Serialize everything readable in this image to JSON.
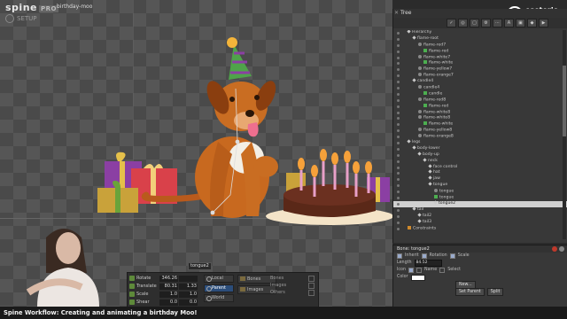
{
  "app": {
    "logo": "spine",
    "edition": "PRO",
    "filename": "birthday-moo",
    "mode_label": "SETUP"
  },
  "bone_tooltip": "tongue2",
  "tools": {
    "transform": [
      {
        "label": "Rotate",
        "x": "346.26",
        "y": ""
      },
      {
        "label": "Translate",
        "x": "80.31",
        "y": "1.33"
      },
      {
        "label": "Scale",
        "x": "1.0",
        "y": "1.0"
      },
      {
        "label": "Shear",
        "x": "0.0",
        "y": "0.0"
      }
    ],
    "axes": [
      {
        "label": "Local",
        "active": false
      },
      {
        "label": "Parent",
        "active": true
      },
      {
        "label": "World",
        "active": false
      }
    ],
    "compensate": [
      "Bones",
      "Images"
    ],
    "options": [
      "Bones",
      "Images",
      "Others"
    ]
  },
  "tree": {
    "title": "Tree",
    "search_label": "Search",
    "nodes": [
      {
        "label": "Hierarchy",
        "kind": "bone",
        "indent": 1
      },
      {
        "label": "flame-root",
        "kind": "bone",
        "indent": 2
      },
      {
        "label": "flame-red7",
        "kind": "slot",
        "indent": 3
      },
      {
        "label": "flame-red",
        "kind": "att",
        "indent": 4
      },
      {
        "label": "flame-white7",
        "kind": "slot",
        "indent": 3
      },
      {
        "label": "flame-white",
        "kind": "att",
        "indent": 4
      },
      {
        "label": "flame-yellow7",
        "kind": "slot",
        "indent": 3
      },
      {
        "label": "flame-orange7",
        "kind": "slot",
        "indent": 3
      },
      {
        "label": "candle4",
        "kind": "bone",
        "indent": 2
      },
      {
        "label": "candle4",
        "kind": "slot",
        "indent": 3
      },
      {
        "label": "candle",
        "kind": "att",
        "indent": 4
      },
      {
        "label": "flame-red8",
        "kind": "slot",
        "indent": 3
      },
      {
        "label": "flame-red",
        "kind": "att",
        "indent": 4
      },
      {
        "label": "flame-white8",
        "kind": "slot",
        "indent": 3
      },
      {
        "label": "flame-white8",
        "kind": "slot",
        "indent": 3
      },
      {
        "label": "flame-white",
        "kind": "att",
        "indent": 4
      },
      {
        "label": "flame-yellow8",
        "kind": "slot",
        "indent": 3
      },
      {
        "label": "flame-orange8",
        "kind": "slot",
        "indent": 3
      },
      {
        "label": "legs",
        "kind": "bone",
        "indent": 1
      },
      {
        "label": "body-lower",
        "kind": "bone",
        "indent": 2
      },
      {
        "label": "body-up",
        "kind": "bone",
        "indent": 3
      },
      {
        "label": "neck",
        "kind": "bone",
        "indent": 4
      },
      {
        "label": "face control",
        "kind": "bone",
        "indent": 5
      },
      {
        "label": "hat",
        "kind": "bone",
        "indent": 5
      },
      {
        "label": "jaw",
        "kind": "bone",
        "indent": 5
      },
      {
        "label": "tongue",
        "kind": "bone",
        "indent": 5
      },
      {
        "label": "tongue",
        "kind": "slot",
        "indent": 6
      },
      {
        "label": "tongue",
        "kind": "att",
        "indent": 6
      },
      {
        "label": "tongue2",
        "kind": "bone",
        "indent": 6,
        "selected": true
      },
      {
        "label": "tail",
        "kind": "bone",
        "indent": 2
      },
      {
        "label": "tail2",
        "kind": "bone",
        "indent": 3
      },
      {
        "label": "tail3",
        "kind": "bone",
        "indent": 3
      },
      {
        "label": "Constraints",
        "kind": "warm",
        "indent": 1
      }
    ]
  },
  "props": {
    "title": "Bone: tongue2",
    "inherit_label": "Inherit",
    "rotation_label": "Rotation",
    "scale_label": "Scale",
    "length_label": "Length",
    "length_value": "84.52",
    "icon_label": "Icon",
    "name_label": "Name",
    "select_label": "Select",
    "color_label": "Color",
    "new_button": "New...",
    "set_parent_button": "Set Parent",
    "split_button": "Split"
  },
  "brand": {
    "line1": "esoteric",
    "line2": "software"
  },
  "caption": "Spine Workflow: Creating and animating a birthday Moo!",
  "colors": {
    "accent": "#2b4d7a",
    "viewport": "#4a4a4a",
    "panel": "#383838"
  }
}
